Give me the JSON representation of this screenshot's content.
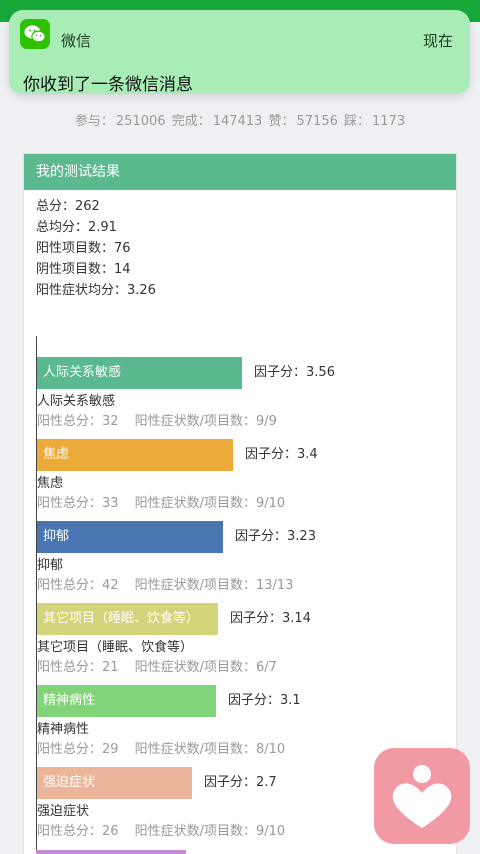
{
  "notification": {
    "app_name": "微信",
    "time": "现在",
    "message": "你收到了一条微信消息"
  },
  "stats": {
    "participants_label": "参与：",
    "participants": "251006",
    "completed_label": "完成：",
    "completed": "147413",
    "likes_label": "赞：",
    "likes": "57156",
    "dislikes_label": "踩：",
    "dislikes": "1173"
  },
  "card": {
    "title": "我的测试结果",
    "summary": [
      "总分：262",
      "总均分：2.91",
      "阳性项目数：76",
      "阴性项目数：14",
      "阳性症状均分：3.26"
    ]
  },
  "chart_data": {
    "type": "bar",
    "categories": [
      "人际关系敏感",
      "焦虑",
      "抑郁",
      "其它项目（睡眠、饮食等）",
      "精神病性",
      "强迫症状"
    ],
    "values": [
      3.56,
      3.4,
      3.23,
      3.14,
      3.1,
      2.7
    ],
    "colors": [
      "#5bb98e",
      "#ecaa3a",
      "#4b75b0",
      "#d4d47a",
      "#82d47a",
      "#ecb59a"
    ],
    "score_prefix": "因子分：",
    "details": [
      {
        "total_label": "阳性总分：",
        "total": "32",
        "ratio_label": "阳性症状数/项目数：",
        "ratio": "9/9"
      },
      {
        "total_label": "阳性总分：",
        "total": "33",
        "ratio_label": "阳性症状数/项目数：",
        "ratio": "9/10"
      },
      {
        "total_label": "阳性总分：",
        "total": "42",
        "ratio_label": "阳性症状数/项目数：",
        "ratio": "13/13"
      },
      {
        "total_label": "阳性总分：",
        "total": "21",
        "ratio_label": "阳性症状数/项目数：",
        "ratio": "6/7"
      },
      {
        "total_label": "阳性总分：",
        "total": "29",
        "ratio_label": "阳性症状数/项目数：",
        "ratio": "8/10"
      },
      {
        "total_label": "阳性总分：",
        "total": "26",
        "ratio_label": "阳性症状数/项目数：",
        "ratio": "9/10"
      }
    ]
  },
  "icons": {
    "notification_app_icon": "wechat-icon",
    "floating_icon": "heart-icon"
  }
}
